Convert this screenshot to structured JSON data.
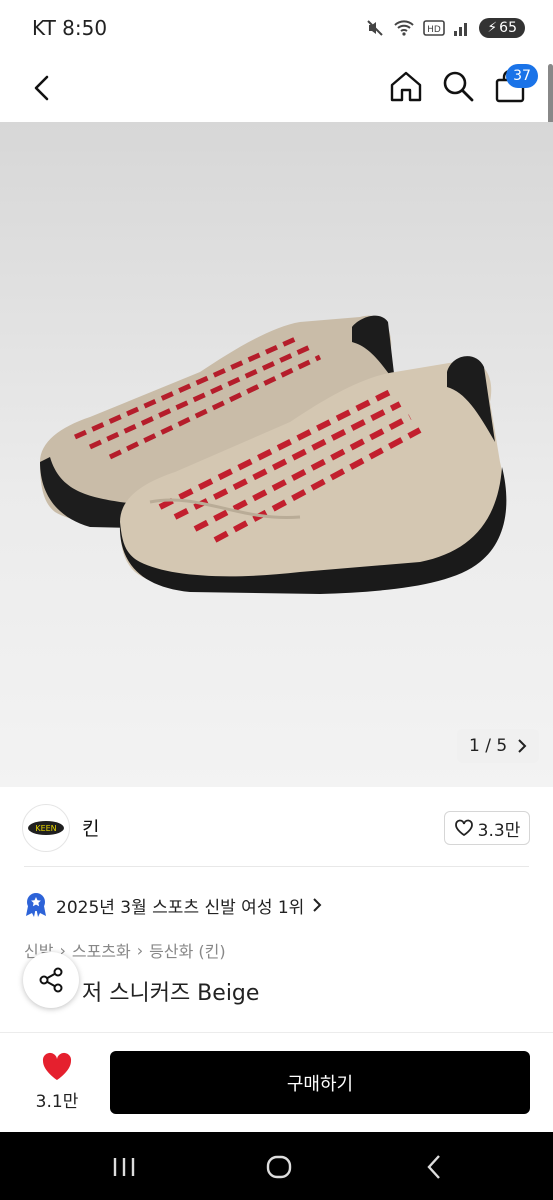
{
  "status_bar": {
    "carrier_time": "KT 8:50",
    "battery": "65"
  },
  "header": {
    "cart_count": "37"
  },
  "gallery": {
    "counter": "1 / 5"
  },
  "brand": {
    "name": "킨",
    "logo_text": "KEEN",
    "likes": "3.3만"
  },
  "ranking": {
    "text": "2025년 3월 스포츠 신발 여성 1위"
  },
  "breadcrumb": [
    "신발",
    "스포츠화",
    "등산화 (킨)"
  ],
  "product": {
    "title_visible": "저 스니커즈 Beige"
  },
  "bottom_bar": {
    "wish_count": "3.1만",
    "buy_label": "구매하기"
  },
  "colors": {
    "accent_blue": "#1a73e8",
    "heart_red": "#e5202e",
    "badge_blue": "#2d63d8"
  },
  "icons": [
    "back-icon",
    "home-icon",
    "search-icon",
    "cart-icon",
    "heart-icon",
    "share-icon",
    "rank-badge-icon",
    "chevron-right-icon"
  ]
}
